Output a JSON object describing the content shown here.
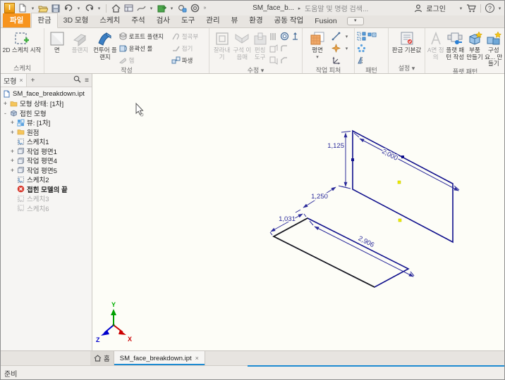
{
  "titlebar": {
    "doc_title": "SM_face_b...",
    "search_text": "도움말 및 명령 검색...",
    "login_label": "로그인"
  },
  "icons": {
    "chevron_down": "▾",
    "chevron_right": "▸",
    "close": "×",
    "plus": "+",
    "minus": "-",
    "hamburger": "≡",
    "more": "»"
  },
  "ribbon_tabs": {
    "items": [
      {
        "label": "파일"
      },
      {
        "label": "판금"
      },
      {
        "label": "3D 모형"
      },
      {
        "label": "스케치"
      },
      {
        "label": "주석"
      },
      {
        "label": "검사"
      },
      {
        "label": "도구"
      },
      {
        "label": "관리"
      },
      {
        "label": "뷰"
      },
      {
        "label": "환경"
      },
      {
        "label": "공동 작업"
      },
      {
        "label": "Fusion"
      }
    ]
  },
  "ribbon": {
    "sketch": {
      "group_label": "스케치",
      "start_2d": "2D 스케치 시작"
    },
    "create": {
      "group_label": "작성",
      "face": "면",
      "flange": "플랜지",
      "contour_flange": "컨투어 플랜지",
      "loft_flange": "로프트 플랜지",
      "contour_roll": "윤곽선 롤",
      "hem": "헴",
      "bend": "절곡부",
      "fold": "접기",
      "derive": "파생"
    },
    "modify": {
      "group_label": "수정",
      "cut": "잘라내기",
      "corner_seam": "구석 이음매",
      "punch_tool": "펀칭 도구"
    },
    "work_features": {
      "group_label": "작업 피쳐",
      "plane": "평면"
    },
    "pattern": {
      "group_label": "패턴"
    },
    "settings": {
      "group_label": "설정",
      "sheet_metal_defaults": "판금 기본값"
    },
    "flat_pattern": {
      "group_label": "플랫 패턴",
      "a_side": "A면 정의",
      "create_flat_pattern": "플랫 패턴 작성",
      "make_part": "부품 만들기",
      "make_components": "구성요... 만들기"
    }
  },
  "browser": {
    "tab_label": "모형",
    "tree": [
      {
        "label": "SM_face_breakdown.ipt",
        "expander": ""
      },
      {
        "label": "모형 상태: [1차]",
        "expander": "+"
      },
      {
        "label": "접힌 모형",
        "expander": "-"
      },
      {
        "label": "뷰: [1차]",
        "expander": "+"
      },
      {
        "label": "원점",
        "expander": "+"
      },
      {
        "label": "스케치1",
        "expander": ""
      },
      {
        "label": "작업 평면1",
        "expander": "+"
      },
      {
        "label": "작업 평면4",
        "expander": "+"
      },
      {
        "label": "작업 평면5",
        "expander": "+"
      },
      {
        "label": "스케치2",
        "expander": ""
      },
      {
        "label": "접힌 모델의 끝",
        "expander": ""
      },
      {
        "label": "스케치3",
        "expander": ""
      },
      {
        "label": "스케치6",
        "expander": ""
      }
    ]
  },
  "viewport": {
    "dimensions": {
      "upper_height": "1,125",
      "upper_width": "2,000",
      "gap": "1,250",
      "lower_depth": "1,031",
      "lower_width": "2,906"
    },
    "triad": {
      "x": "X",
      "y": "Y",
      "z": "Z"
    }
  },
  "doc_tabs": {
    "home_label": "홈",
    "active_doc": "SM_face_breakdown.ipt"
  },
  "statusbar": {
    "ready": "준비"
  },
  "colors": {
    "accent_blue": "#1e8bd1",
    "file_tab_orange": "#f7941e",
    "sketch_line_navy": "#10108c",
    "dimension_blue": "#2a2a9a",
    "point_yellow": "#f0f000"
  }
}
